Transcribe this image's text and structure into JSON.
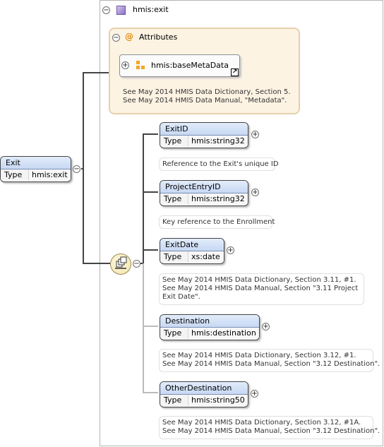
{
  "root": {
    "name": "Exit",
    "type_label": "Type",
    "type_value": "hmis:exit"
  },
  "complex_type": {
    "name": "hmis:exit",
    "collapse_symbol": "−"
  },
  "attributes": {
    "title": "Attributes",
    "at_symbol": "@",
    "collapse_symbol": "−",
    "group": {
      "name": "hmis:baseMetaData",
      "expand_symbol": "+",
      "link_symbol": "↗"
    },
    "note_lines": [
      "See May 2014 HMIS Data Dictionary, Section 5.",
      "See May 2014 HMIS Data Manual, \"Metadata\"."
    ]
  },
  "sequence": {
    "collapse_symbol": "−"
  },
  "elements": [
    {
      "name": "ExitID",
      "type_label": "Type",
      "type_value": "hmis:string32",
      "expand_symbol": "+",
      "note_lines": [
        "Reference to the Exit's unique ID"
      ]
    },
    {
      "name": "ProjectEntryID",
      "type_label": "Type",
      "type_value": "hmis:string32",
      "expand_symbol": "+",
      "note_lines": [
        "Key reference to the Enrollment"
      ]
    },
    {
      "name": "ExitDate",
      "type_label": "Type",
      "type_value": "xs:date",
      "expand_symbol": "+",
      "note_lines": [
        "See May 2014 HMIS Data Dictionary, Section 3.11, #1.",
        "See May 2014 HMIS Data Manual, Section \"3.11 Project",
        "Exit Date\"."
      ]
    },
    {
      "name": "Destination",
      "type_label": "Type",
      "type_value": "hmis:destination",
      "expand_symbol": "+",
      "note_lines": [
        "See May 2014 HMIS Data Dictionary, Section 3.12, #1.",
        "See May 2014 HMIS Data Manual, Section \"3.12 Destination\"."
      ]
    },
    {
      "name": "OtherDestination",
      "type_label": "Type",
      "type_value": "hmis:string50",
      "expand_symbol": "+",
      "note_lines": [
        "See May 2014 HMIS Data Dictionary, Section 3.12, #1A.",
        "See May 2014 HMIS Data Manual, Section \"3.12 Destination\"."
      ]
    }
  ],
  "root_collapse_symbol": "−"
}
